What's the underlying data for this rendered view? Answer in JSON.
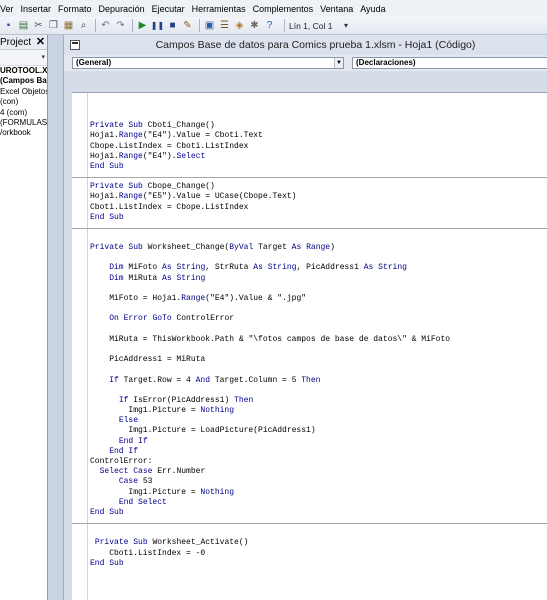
{
  "menu": [
    "Ver",
    "Insertar",
    "Formato",
    "Depuración",
    "Ejecutar",
    "Herramientas",
    "Complementos",
    "Ventana",
    "Ayuda"
  ],
  "toolbar": {
    "icons": [
      "save-icon",
      "insert-module-icon",
      "cut-icon",
      "copy-icon",
      "paste-icon",
      "find-icon",
      "undo-icon",
      "redo-icon",
      "run-icon",
      "break-icon",
      "reset-icon",
      "design-mode-icon",
      "project-explorer-icon",
      "properties-icon",
      "object-browser-icon",
      "toolbox-icon",
      "help-icon"
    ],
    "cursor_position": "Lín 1, Col 1"
  },
  "project_pane": {
    "title": "Project",
    "items": [
      "UROTOOL.XLA",
      "(Campos Bas",
      "Excel Objetos",
      "(con)",
      "4 (com)",
      "(FORMULAS D",
      "/orkbook"
    ]
  },
  "code_window": {
    "title": "Campos Base de datos para Comics prueba 1.xlsm - Hoja1 (Código)",
    "object_combo": "(General)",
    "proc_combo": "(Declaraciones)"
  },
  "code_lines": [
    {
      "t": ""
    },
    {
      "t": "Private Sub Cboti_Change()"
    },
    {
      "t": "Hoja1.Range(\"E4\").Value = Cboti.Text"
    },
    {
      "t": "Cbope.ListIndex = Cboti.ListIndex"
    },
    {
      "t": "Hoja1.Range(\"E4\").Select"
    },
    {
      "t": "End Sub"
    },
    {
      "sep": true
    },
    {
      "t": "Private Sub Cbope_Change()"
    },
    {
      "t": "Hoja1.Range(\"E5\").Value = UCase(Cbope.Text)"
    },
    {
      "t": "Cboti.ListIndex = Cbope.ListIndex"
    },
    {
      "t": "End Sub"
    },
    {
      "sep": true
    },
    {
      "t": ""
    },
    {
      "t": "Private Sub Worksheet_Change(ByVal Target As Range)"
    },
    {
      "t": ""
    },
    {
      "t": "    Dim MiFoto As String, StrRuta As String, PicAddress1 As String"
    },
    {
      "t": "    Dim MiRuta As String"
    },
    {
      "t": ""
    },
    {
      "t": "    MiFoto = Hoja1.Range(\"E4\").Value & \".jpg\""
    },
    {
      "t": ""
    },
    {
      "t": "    On Error GoTo ControlError"
    },
    {
      "t": ""
    },
    {
      "t": "    MiRuta = ThisWorkbook.Path & \"\\fotos campos de base de datos\\\" & MiFoto"
    },
    {
      "t": ""
    },
    {
      "t": "    PicAddress1 = MiRuta"
    },
    {
      "t": ""
    },
    {
      "t": "    If Target.Row = 4 And Target.Column = 5 Then"
    },
    {
      "t": ""
    },
    {
      "t": "      If IsError(PicAddress1) Then"
    },
    {
      "t": "        Img1.Picture = Nothing"
    },
    {
      "t": "      Else"
    },
    {
      "t": "        Img1.Picture = LoadPicture(PicAddress1)"
    },
    {
      "t": "      End If"
    },
    {
      "t": "    End If"
    },
    {
      "t": "ControlError:"
    },
    {
      "t": "  Select Case Err.Number"
    },
    {
      "t": "      Case 53"
    },
    {
      "t": "        Img1.Picture = Nothing"
    },
    {
      "t": "      End Select"
    },
    {
      "t": "End Sub"
    },
    {
      "sep": true
    },
    {
      "t": ""
    },
    {
      "t": " Private Sub Worksheet_Activate()"
    },
    {
      "t": "    Cboti.ListIndex = -0"
    },
    {
      "t": "End Sub"
    }
  ]
}
